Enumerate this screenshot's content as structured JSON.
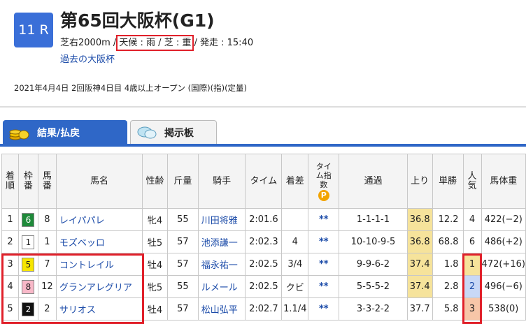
{
  "race": {
    "number": "11 R",
    "title": "第65回大阪杯(G1)",
    "course": "芝右2000m",
    "weather_track": "天候 : 雨 / 芝 : 重",
    "start_label": "発走 : 15:40",
    "past_link": "過去の大阪杯",
    "detail": "2021年4月4日 2回阪神4日目 4歳以上オープン (国際)(指)(定量)"
  },
  "tabs": {
    "results": "結果/払戻",
    "board": "掲示板"
  },
  "table": {
    "headers": {
      "rank": "着順",
      "waku": "枠番",
      "umaban": "馬番",
      "name": "馬名",
      "sexage": "性齢",
      "weight": "斤量",
      "jockey": "騎手",
      "time": "タイム",
      "margin": "着差",
      "time_index": "タイム指数",
      "passing": "通過",
      "agari": "上り",
      "odds": "単勝",
      "popularity": "人気",
      "body_weight": "馬体重"
    },
    "p_badge": "P",
    "rows": [
      {
        "rank": "1",
        "waku": "6",
        "umaban": "8",
        "name": "レイパパレ",
        "sexage": "牝4",
        "weight": "55",
        "jockey": "川田将雅",
        "time": "2:01.6",
        "margin": "",
        "time_index": "**",
        "passing": "1-1-1-1",
        "agari": "36.8",
        "odds": "12.2",
        "popularity": "4",
        "body_weight": "422(−2)"
      },
      {
        "rank": "2",
        "waku": "1",
        "umaban": "1",
        "name": "モズベッロ",
        "sexage": "牡5",
        "weight": "57",
        "jockey": "池添謙一",
        "time": "2:02.3",
        "margin": "4",
        "time_index": "**",
        "passing": "10-10-9-5",
        "agari": "36.8",
        "odds": "68.8",
        "popularity": "6",
        "body_weight": "486(+2)"
      },
      {
        "rank": "3",
        "waku": "5",
        "umaban": "7",
        "name": "コントレイル",
        "sexage": "牡4",
        "weight": "57",
        "jockey": "福永祐一",
        "time": "2:02.5",
        "margin": "3/4",
        "time_index": "**",
        "passing": "9-9-6-2",
        "agari": "37.4",
        "odds": "1.8",
        "popularity": "1",
        "body_weight": "472(+16)"
      },
      {
        "rank": "4",
        "waku": "8",
        "umaban": "12",
        "name": "グランアレグリア",
        "sexage": "牝5",
        "weight": "55",
        "jockey": "ルメール",
        "time": "2:02.5",
        "margin": "クビ",
        "time_index": "**",
        "passing": "5-5-5-2",
        "agari": "37.4",
        "odds": "2.8",
        "popularity": "2",
        "body_weight": "496(−6)"
      },
      {
        "rank": "5",
        "waku": "2",
        "umaban": "2",
        "name": "サリオス",
        "sexage": "牡4",
        "weight": "57",
        "jockey": "松山弘平",
        "time": "2:02.7",
        "margin": "1.1/4",
        "time_index": "**",
        "passing": "3-3-2-2",
        "agari": "37.7",
        "odds": "5.8",
        "popularity": "3",
        "body_weight": "538(0)"
      }
    ]
  }
}
